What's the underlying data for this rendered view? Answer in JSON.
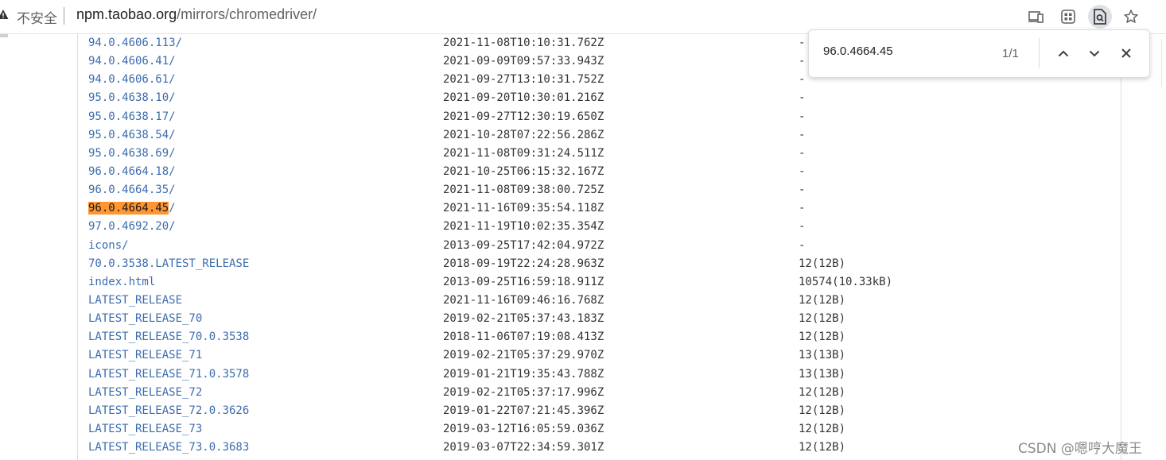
{
  "browser": {
    "security_label": "不安全",
    "url_host": "npm.taobao.org",
    "url_path": "/mirrors/chromedriver/",
    "toolbar_icons": [
      "install-app-icon",
      "extensions-grid-icon",
      "find-in-page-icon",
      "bookmark-star-icon"
    ]
  },
  "find_bar": {
    "query": "96.0.4664.45",
    "count": "1/1"
  },
  "listing": {
    "rows": [
      {
        "name": "94.0.4606.113/",
        "date": "2021-11-08T10:10:31.762Z",
        "size": "-"
      },
      {
        "name": "94.0.4606.41/",
        "date": "2021-09-09T09:57:33.943Z",
        "size": "-"
      },
      {
        "name": "94.0.4606.61/",
        "date": "2021-09-27T13:10:31.752Z",
        "size": "-"
      },
      {
        "name": "95.0.4638.10/",
        "date": "2021-09-20T10:30:01.216Z",
        "size": "-"
      },
      {
        "name": "95.0.4638.17/",
        "date": "2021-09-27T12:30:19.650Z",
        "size": "-"
      },
      {
        "name": "95.0.4638.54/",
        "date": "2021-10-28T07:22:56.286Z",
        "size": "-"
      },
      {
        "name": "95.0.4638.69/",
        "date": "2021-11-08T09:31:24.511Z",
        "size": "-"
      },
      {
        "name": "96.0.4664.18/",
        "date": "2021-10-25T06:15:32.167Z",
        "size": "-"
      },
      {
        "name": "96.0.4664.35/",
        "date": "2021-11-08T09:38:00.725Z",
        "size": "-"
      },
      {
        "name_highlight": "96.0.4664.45",
        "name_rest": "/",
        "date": "2021-11-16T09:35:54.118Z",
        "size": "-"
      },
      {
        "name": "97.0.4692.20/",
        "date": "2021-11-19T10:02:35.354Z",
        "size": "-"
      },
      {
        "name": "icons/",
        "date": "2013-09-25T17:42:04.972Z",
        "size": "-"
      },
      {
        "name": "70.0.3538.LATEST_RELEASE",
        "date": "2018-09-19T22:24:28.963Z",
        "size": "12(12B)"
      },
      {
        "name": "index.html",
        "date": "2013-09-25T16:59:18.911Z",
        "size": "10574(10.33kB)"
      },
      {
        "name": "LATEST_RELEASE",
        "date": "2021-11-16T09:46:16.768Z",
        "size": "12(12B)"
      },
      {
        "name": "LATEST_RELEASE_70",
        "date": "2019-02-21T05:37:43.183Z",
        "size": "12(12B)"
      },
      {
        "name": "LATEST_RELEASE_70.0.3538",
        "date": "2018-11-06T07:19:08.413Z",
        "size": "12(12B)"
      },
      {
        "name": "LATEST_RELEASE_71",
        "date": "2019-02-21T05:37:29.970Z",
        "size": "13(13B)"
      },
      {
        "name": "LATEST_RELEASE_71.0.3578",
        "date": "2019-01-21T19:35:43.788Z",
        "size": "13(13B)"
      },
      {
        "name": "LATEST_RELEASE_72",
        "date": "2019-02-21T05:37:17.996Z",
        "size": "12(12B)"
      },
      {
        "name": "LATEST_RELEASE_72.0.3626",
        "date": "2019-01-22T07:21:45.396Z",
        "size": "12(12B)"
      },
      {
        "name": "LATEST_RELEASE_73",
        "date": "2019-03-12T16:05:59.036Z",
        "size": "12(12B)"
      },
      {
        "name": "LATEST_RELEASE_73.0.3683",
        "date": "2019-03-07T22:34:59.301Z",
        "size": "12(12B)"
      }
    ]
  },
  "watermark": "CSDN @嗯哼大魔王",
  "colors": {
    "link": "#3c6cae",
    "highlight": "#ff9632",
    "text": "#333333"
  }
}
